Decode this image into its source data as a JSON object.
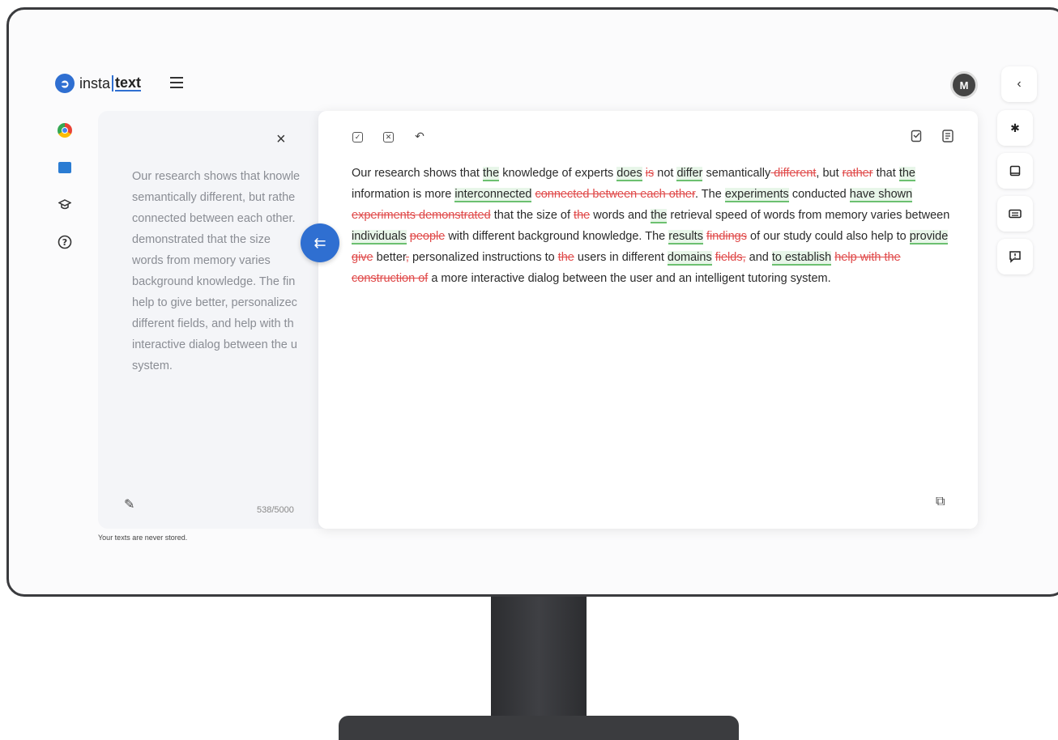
{
  "app": {
    "brand_prefix": "insta",
    "brand_suffix": "text",
    "avatar_initial": "M"
  },
  "input": {
    "text": "Our research shows that knowle\nsemantically different, but rathe\nconnected between each other.\ndemonstrated that the size\nwords from memory varies\nbackground knowledge. The fin\nhelp to give better, personalizec\ndifferent fields, and help with th\ninteractive dialog between the u\nsystem.",
    "counter": "538/5000",
    "note": "Your texts are never stored."
  },
  "output": {
    "segments": [
      {
        "t": "Our research shows that ",
        "k": "n"
      },
      {
        "t": "the",
        "k": "i"
      },
      {
        "t": " knowledge of experts ",
        "k": "n"
      },
      {
        "t": "does",
        "k": "i"
      },
      {
        "t": " ",
        "k": "n"
      },
      {
        "t": "is",
        "k": "d"
      },
      {
        "t": " not ",
        "k": "n"
      },
      {
        "t": "differ",
        "k": "i"
      },
      {
        "t": " semantically",
        "k": "n"
      },
      {
        "t": " different",
        "k": "d"
      },
      {
        "t": ", but ",
        "k": "n"
      },
      {
        "t": "rather",
        "k": "d"
      },
      {
        "t": " that ",
        "k": "n"
      },
      {
        "t": "the",
        "k": "i"
      },
      {
        "t": " information is more ",
        "k": "n"
      },
      {
        "t": "interconnected",
        "k": "i"
      },
      {
        "t": " ",
        "k": "n"
      },
      {
        "t": "connected between each other",
        "k": "d"
      },
      {
        "t": ". The ",
        "k": "n"
      },
      {
        "t": "experiments",
        "k": "i"
      },
      {
        "t": " conducted ",
        "k": "n"
      },
      {
        "t": "have shown",
        "k": "i"
      },
      {
        "t": " ",
        "k": "n"
      },
      {
        "t": "experiments demonstrated",
        "k": "d"
      },
      {
        "t": " that the size of ",
        "k": "n"
      },
      {
        "t": "the",
        "k": "d"
      },
      {
        "t": " words and ",
        "k": "n"
      },
      {
        "t": "the",
        "k": "i"
      },
      {
        "t": " retrieval speed of words from memory varies between ",
        "k": "n"
      },
      {
        "t": "individuals",
        "k": "i"
      },
      {
        "t": " ",
        "k": "n"
      },
      {
        "t": "people",
        "k": "d"
      },
      {
        "t": " with different background knowledge. The ",
        "k": "n"
      },
      {
        "t": "results",
        "k": "i"
      },
      {
        "t": " ",
        "k": "n"
      },
      {
        "t": "findings",
        "k": "d"
      },
      {
        "t": " of our study could also help to ",
        "k": "n"
      },
      {
        "t": "provide",
        "k": "i"
      },
      {
        "t": " ",
        "k": "n"
      },
      {
        "t": "give",
        "k": "d"
      },
      {
        "t": " better",
        "k": "n"
      },
      {
        "t": ",",
        "k": "d"
      },
      {
        "t": " personalized instructions to ",
        "k": "n"
      },
      {
        "t": "the",
        "k": "d"
      },
      {
        "t": " users in different ",
        "k": "n"
      },
      {
        "t": "domains",
        "k": "i"
      },
      {
        "t": " ",
        "k": "n"
      },
      {
        "t": "fields,",
        "k": "d"
      },
      {
        "t": " and ",
        "k": "n"
      },
      {
        "t": "to establish",
        "k": "i"
      },
      {
        "t": " ",
        "k": "n"
      },
      {
        "t": "help with the construction of",
        "k": "d"
      },
      {
        "t": " a more interactive dialog between the user and an intelligent tutoring system.",
        "k": "n"
      }
    ]
  },
  "icons": {
    "close": "×",
    "arrow": "⇇",
    "collapse": "‹",
    "undo": "↶",
    "pencil": "✎",
    "copy": "⧉",
    "accept_all": "☑",
    "reject_all": "☒",
    "settings": "✱",
    "side_help": "?",
    "side_grad": "⌂"
  },
  "colors": {
    "accent": "#2f6fd1",
    "insert_underline": "#6cc070",
    "delete_text": "#e04a4a"
  }
}
